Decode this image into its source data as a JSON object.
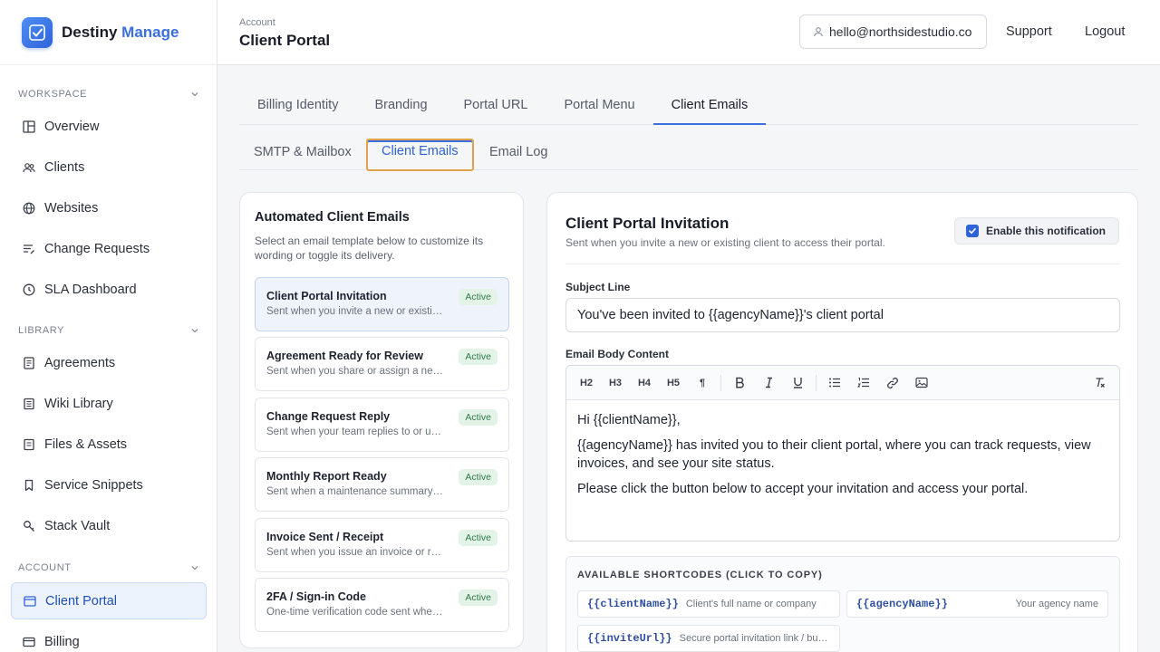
{
  "brand": {
    "name_main": "Destiny",
    "name_accent": "Manage"
  },
  "sidebar": {
    "sections": [
      {
        "title": "WORKSPACE",
        "items": [
          {
            "label": "Overview",
            "icon": "grid-icon"
          },
          {
            "label": "Clients",
            "icon": "users-icon"
          },
          {
            "label": "Websites",
            "icon": "globe-icon"
          },
          {
            "label": "Change Requests",
            "icon": "list-edit-icon"
          },
          {
            "label": "SLA Dashboard",
            "icon": "clock-icon"
          }
        ]
      },
      {
        "title": "LIBRARY",
        "items": [
          {
            "label": "Agreements",
            "icon": "document-icon"
          },
          {
            "label": "Wiki Library",
            "icon": "book-icon"
          },
          {
            "label": "Files & Assets",
            "icon": "folder-icon"
          },
          {
            "label": "Service Snippets",
            "icon": "bookmark-icon"
          },
          {
            "label": "Stack Vault",
            "icon": "key-icon"
          }
        ]
      },
      {
        "title": "ACCOUNT",
        "items": [
          {
            "label": "Client Portal",
            "icon": "window-icon",
            "active": true
          },
          {
            "label": "Billing",
            "icon": "card-icon"
          }
        ]
      }
    ]
  },
  "header": {
    "crumb": "Account",
    "title": "Client Portal",
    "user_email": "hello@northsidestudio.co",
    "support": "Support",
    "logout": "Logout"
  },
  "tabs_primary": [
    "Billing Identity",
    "Branding",
    "Portal URL",
    "Portal Menu",
    "Client Emails"
  ],
  "tabs_secondary": [
    "SMTP & Mailbox",
    "Client Emails",
    "Email Log"
  ],
  "templates_panel": {
    "title": "Automated Client Emails",
    "description": "Select an email template below to customize its wording or toggle its delivery.",
    "items": [
      {
        "name": "Client Portal Invitation",
        "sub": "Sent when you invite a new or existing client",
        "status": "Active"
      },
      {
        "name": "Agreement Ready for Review",
        "sub": "Sent when you share or assign a new agreement",
        "status": "Active"
      },
      {
        "name": "Change Request Reply",
        "sub": "Sent when your team replies to or updates",
        "status": "Active"
      },
      {
        "name": "Monthly Report Ready",
        "sub": "Sent when a maintenance summary is published",
        "status": "Active"
      },
      {
        "name": "Invoice Sent / Receipt",
        "sub": "Sent when you issue an invoice or receive",
        "status": "Active"
      },
      {
        "name": "2FA / Sign-in Code",
        "sub": "One-time verification code sent when signing in",
        "status": "Active"
      }
    ]
  },
  "editor_panel": {
    "title": "Client Portal Invitation",
    "subtitle": "Sent when you invite a new or existing client to access their portal.",
    "enable_label": "Enable this notification",
    "subject_label": "Subject Line",
    "subject_value": "You've been invited to {{agencyName}}'s client portal",
    "body_label": "Email Body Content",
    "toolbar": {
      "h2": "H2",
      "h3": "H3",
      "h4": "H4",
      "h5": "H5",
      "para": "¶"
    },
    "body": {
      "p1": "Hi {{clientName}},",
      "p2": "{{agencyName}} has invited you to their client portal, where you can track requests, view invoices, and see your site status.",
      "p3": "Please click the button below to accept your invitation and access your portal."
    },
    "shortcodes_title": "AVAILABLE SHORTCODES (CLICK TO COPY)",
    "shortcodes": [
      {
        "code": "{{clientName}}",
        "desc": "Client's full name or company"
      },
      {
        "code": "{{agencyName}}",
        "desc": "Your agency name"
      },
      {
        "code": "{{inviteUrl}}",
        "desc": "Secure portal invitation link / button"
      }
    ]
  }
}
